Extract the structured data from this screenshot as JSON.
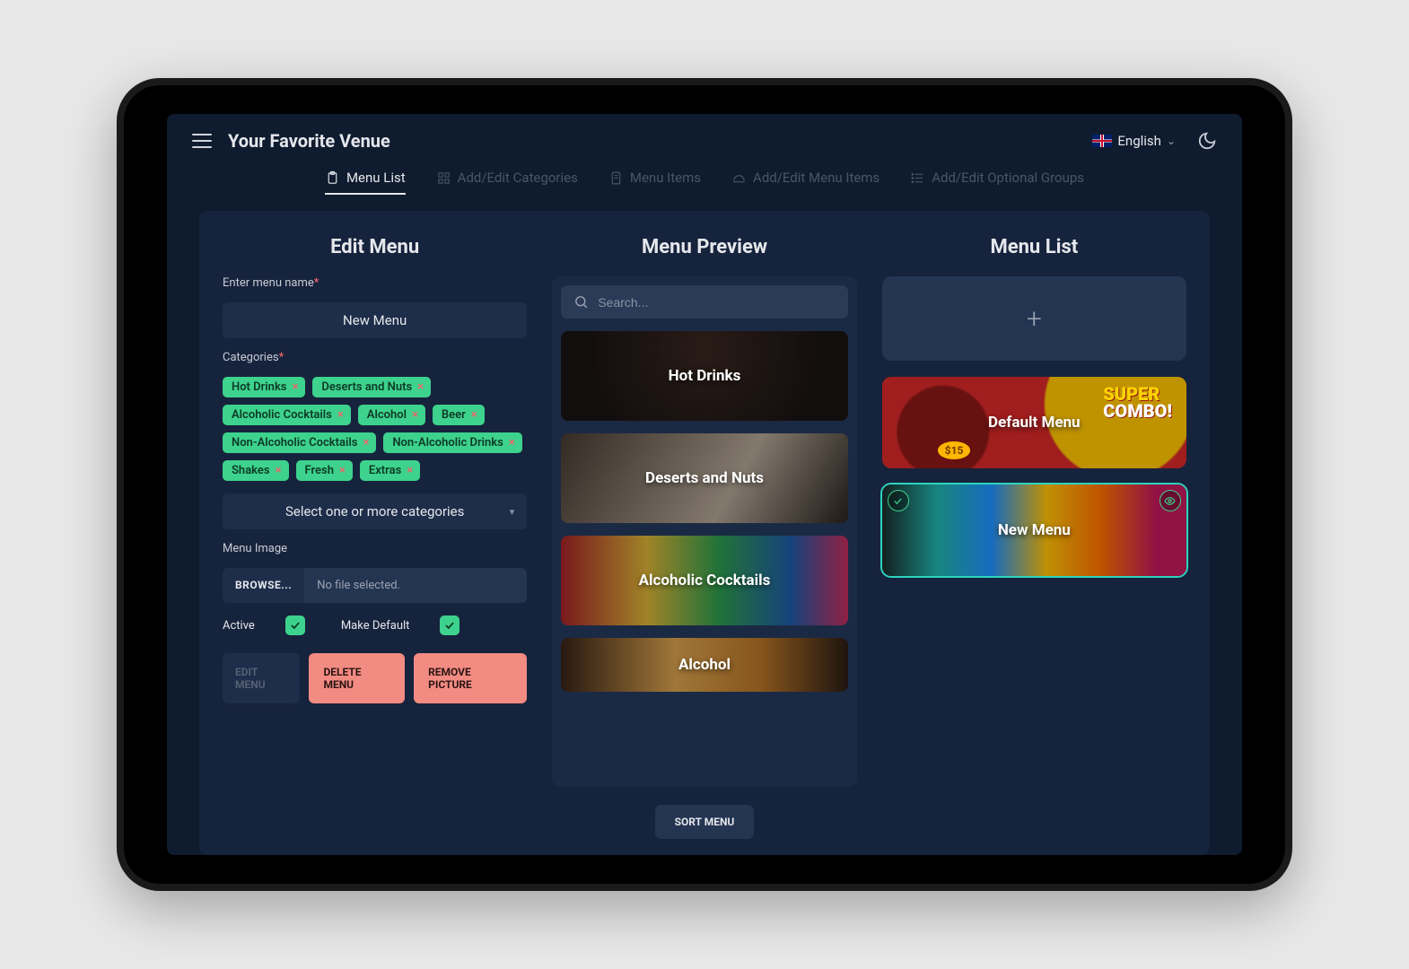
{
  "header": {
    "venue_title": "Your Favorite Venue",
    "language": "English"
  },
  "tabs": [
    {
      "label": "Menu List",
      "active": true
    },
    {
      "label": "Add/Edit Categories",
      "active": false
    },
    {
      "label": "Menu Items",
      "active": false
    },
    {
      "label": "Add/Edit Menu Items",
      "active": false
    },
    {
      "label": "Add/Edit Optional Groups",
      "active": false
    }
  ],
  "edit": {
    "heading": "Edit Menu",
    "name_label": "Enter menu name",
    "name_value": "New Menu",
    "categories_label": "Categories",
    "chips": [
      "Hot Drinks",
      "Deserts and Nuts",
      "Alcoholic Cocktails",
      "Alcohol",
      "Beer",
      "Non-Alcoholic Cocktails",
      "Non-Alcoholic Drinks",
      "Shakes",
      "Fresh",
      "Extras"
    ],
    "select_placeholder": "Select one or more categories",
    "image_label": "Menu Image",
    "browse_label": "BROWSE...",
    "file_status": "No file selected.",
    "active_label": "Active",
    "active_checked": true,
    "default_label": "Make Default",
    "default_checked": true,
    "btn_edit": "EDIT MENU",
    "btn_delete": "DELETE MENU",
    "btn_remove_pic": "REMOVE PICTURE"
  },
  "preview": {
    "heading": "Menu Preview",
    "search_placeholder": "Search...",
    "cards": [
      "Hot Drinks",
      "Deserts and Nuts",
      "Alcoholic Cocktails",
      "Alcohol"
    ],
    "sort_label": "SORT MENU"
  },
  "menulist": {
    "heading": "Menu List",
    "add_symbol": "+",
    "combo_line1": "SUPER",
    "combo_line2": "COMBO!",
    "combo_price": "$15",
    "items": [
      {
        "title": "Default Menu",
        "selected": false
      },
      {
        "title": "New Menu",
        "selected": true
      }
    ]
  }
}
